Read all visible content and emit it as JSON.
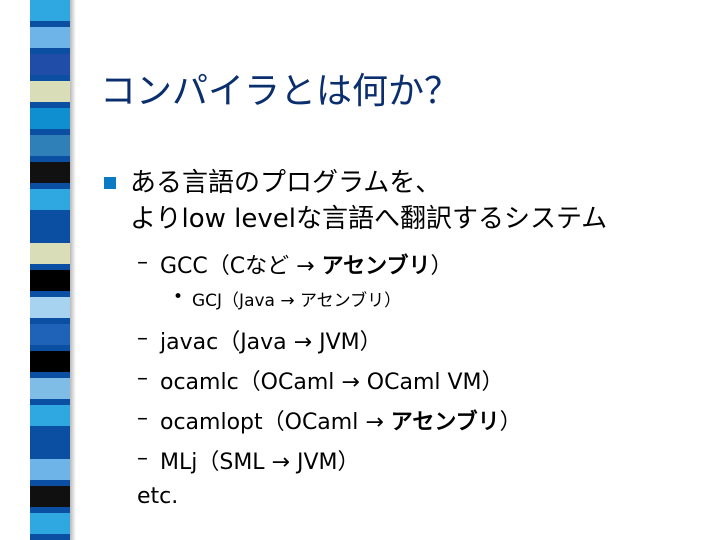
{
  "title": "コンパイラとは何か？",
  "colors": {
    "title": "#0a2e6e",
    "stripe_base": "#0b4fa3",
    "bullet": "#0b7ac4"
  },
  "stripe_colors": [
    "#2fa7e0",
    "#6fb4e8",
    "#1f4da8",
    "#d9ddb8",
    "#0f8fcf",
    "#2f7fb8",
    "#111111",
    "#2fa7e0",
    "#0b4fa3",
    "#d9ddb8",
    "#000000",
    "#a7d3f0",
    "#1f63b8",
    "#000000",
    "#7fbde6",
    "#2fa7e0",
    "#0b4fa3",
    "#6fb4e8",
    "#101010",
    "#2fa7e0"
  ],
  "bullet_icon": "square-bullet",
  "main_point": {
    "line1": "ある言語のプログラムを、",
    "line2": "よりlow levelな言語へ翻訳するシステム"
  },
  "dash_symbol": "–",
  "dot_symbol": "•",
  "items": {
    "gcc": {
      "text": "GCC（Cなど → ",
      "bold": "アセンブリ",
      "close": "）"
    },
    "gcj": {
      "text": "GCJ（Java → アセンブリ）"
    },
    "javac": {
      "text": "javac（Java → JVM）"
    },
    "ocamlc": {
      "text": "ocamlc（OCaml → OCaml VM）"
    },
    "ocamlopt": {
      "text": "ocamlopt（OCaml → ",
      "bold": "アセンブリ",
      "close": "）"
    },
    "mlj": {
      "text": "MLj（SML → JVM）"
    }
  },
  "etc": "etc."
}
